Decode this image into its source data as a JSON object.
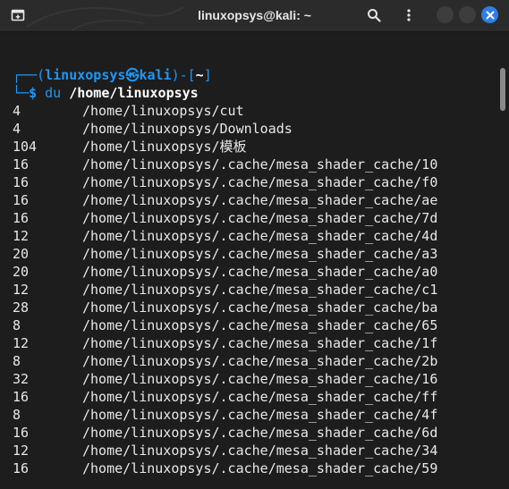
{
  "window": {
    "title": "linuxopsys@kali: ~"
  },
  "icons": {
    "new_tab": "new-tab-icon",
    "search": "search-icon",
    "menu": "kebab-menu-icon",
    "minimize": "minimize-icon",
    "maximize": "maximize-icon",
    "close": "close-icon"
  },
  "colors": {
    "prompt_blue": "#2196f3",
    "close_blue": "#2f7de6",
    "background": "#1d1d1d",
    "titlebar": "#2b2b2b"
  },
  "prompt": {
    "user": "linuxopsys",
    "at_symbol": "㉿",
    "host": "kali",
    "dir": "~",
    "dollar": "$",
    "command": "du",
    "argument": "/home/linuxopsys"
  },
  "output": [
    {
      "size": "4",
      "path": "/home/linuxopsys/cut"
    },
    {
      "size": "4",
      "path": "/home/linuxopsys/Downloads"
    },
    {
      "size": "104",
      "path": "/home/linuxopsys/模板"
    },
    {
      "size": "16",
      "path": "/home/linuxopsys/.cache/mesa_shader_cache/10"
    },
    {
      "size": "16",
      "path": "/home/linuxopsys/.cache/mesa_shader_cache/f0"
    },
    {
      "size": "16",
      "path": "/home/linuxopsys/.cache/mesa_shader_cache/ae"
    },
    {
      "size": "16",
      "path": "/home/linuxopsys/.cache/mesa_shader_cache/7d"
    },
    {
      "size": "12",
      "path": "/home/linuxopsys/.cache/mesa_shader_cache/4d"
    },
    {
      "size": "20",
      "path": "/home/linuxopsys/.cache/mesa_shader_cache/a3"
    },
    {
      "size": "20",
      "path": "/home/linuxopsys/.cache/mesa_shader_cache/a0"
    },
    {
      "size": "12",
      "path": "/home/linuxopsys/.cache/mesa_shader_cache/c1"
    },
    {
      "size": "28",
      "path": "/home/linuxopsys/.cache/mesa_shader_cache/ba"
    },
    {
      "size": "8",
      "path": "/home/linuxopsys/.cache/mesa_shader_cache/65"
    },
    {
      "size": "12",
      "path": "/home/linuxopsys/.cache/mesa_shader_cache/1f"
    },
    {
      "size": "8",
      "path": "/home/linuxopsys/.cache/mesa_shader_cache/2b"
    },
    {
      "size": "32",
      "path": "/home/linuxopsys/.cache/mesa_shader_cache/16"
    },
    {
      "size": "16",
      "path": "/home/linuxopsys/.cache/mesa_shader_cache/ff"
    },
    {
      "size": "8",
      "path": "/home/linuxopsys/.cache/mesa_shader_cache/4f"
    },
    {
      "size": "16",
      "path": "/home/linuxopsys/.cache/mesa_shader_cache/6d"
    },
    {
      "size": "12",
      "path": "/home/linuxopsys/.cache/mesa_shader_cache/34"
    },
    {
      "size": "16",
      "path": "/home/linuxopsys/.cache/mesa_shader_cache/59"
    }
  ]
}
